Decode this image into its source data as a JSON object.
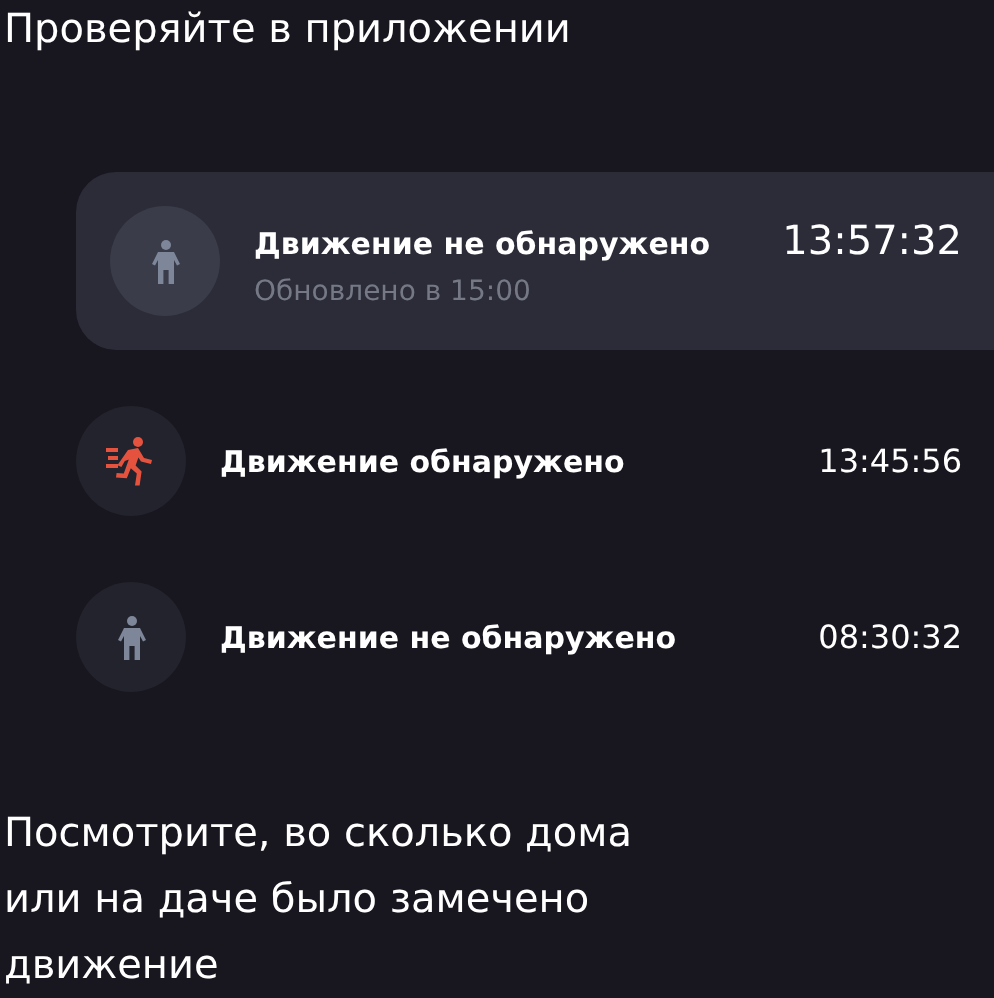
{
  "heading": "Проверяйте в приложении",
  "latest": {
    "kind": "still",
    "title": "Движение не обнаружено",
    "time": "13:57:32",
    "subtitle": "Обновлено в 15:00"
  },
  "events": [
    {
      "kind": "motion",
      "title": "Движение обнаружено",
      "time": "13:45:56"
    },
    {
      "kind": "still",
      "title": "Движение не обнаружено",
      "time": "08:30:32"
    }
  ],
  "caption": "Посмотрите, во сколько дома или на даче было замечено движение"
}
